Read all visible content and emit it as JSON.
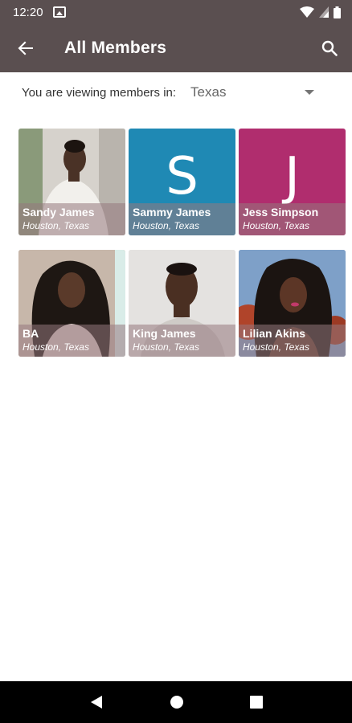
{
  "status_bar": {
    "time": "12:20"
  },
  "app_bar": {
    "title": "All Members"
  },
  "filter": {
    "label": "You are viewing members in:",
    "value": "Texas"
  },
  "members": [
    {
      "name": "Sandy James",
      "location": "Houston, Texas"
    },
    {
      "name": "Sammy James",
      "location": "Houston, Texas",
      "initial": "S",
      "color": "#1f89b4"
    },
    {
      "name": "Jess Simpson",
      "location": "Houston, Texas",
      "initial": "J",
      "color": "#b02d6e"
    },
    {
      "name": "BA",
      "location": "Houston, Texas"
    },
    {
      "name": "King James",
      "location": "Houston, Texas"
    },
    {
      "name": "Lilian Akins",
      "location": "Houston, Texas"
    }
  ],
  "colors": {
    "app_bar": "#5a4f50",
    "overlay": "#967880"
  }
}
